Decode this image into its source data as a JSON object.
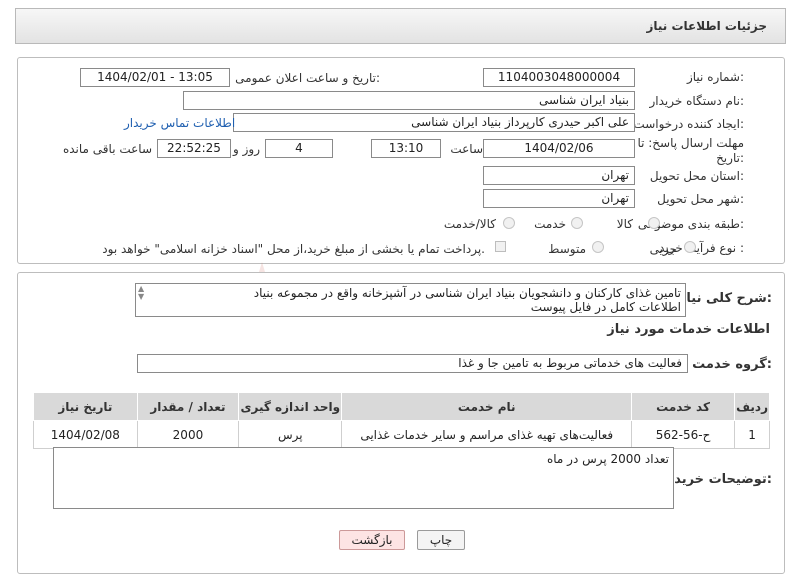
{
  "header": {
    "title": "جزئیات اطلاعات نیاز"
  },
  "fields": {
    "need_number_label": "شماره نیاز:",
    "need_number": "1104003048000004",
    "announce_label": "تاریخ و ساعت اعلان عمومی:",
    "announce_value": "1404/02/01 - 13:05",
    "buyer_org_label": "نام دستگاه خریدار:",
    "buyer_org": "بنیاد ایران شناسی",
    "creator_label": "ایجاد کننده درخواست:",
    "creator": "علی اکبر حیدری کارپرداز بنیاد ایران شناسی",
    "contact_link": "اطلاعات تماس خریدار",
    "deadline_label_1": "مهلت ارسال پاسخ: تا",
    "deadline_label_2": "تاریخ:",
    "deadline_date": "1404/02/06",
    "time_label": "ساعت",
    "deadline_time": "13:10",
    "days_value": "4",
    "days_label": "روز و",
    "remaining_time": "22:52:25",
    "remaining_label": "ساعت باقی مانده",
    "province_label": "استان محل تحویل:",
    "province": "تهران",
    "city_label": "شهر محل تحویل:",
    "city": "تهران",
    "category_label": "طبقه بندی موضوعی:",
    "category_options": [
      "کالا",
      "خدمت",
      "کالا/خدمت"
    ],
    "purchase_type_label": "نوع فرآیند خرید :",
    "purchase_options": [
      "جزیی",
      "متوسط"
    ],
    "payment_note": "پرداخت تمام یا بخشی از مبلغ خرید،از محل \"اسناد خزانه اسلامی\" خواهد بود."
  },
  "description": {
    "label": "شرح کلی نیاز:",
    "line1": "تامین غذای کارکنان و دانشجویان بنیاد ایران شناسی در آشپزخانه واقع در مجموعه بنیاد",
    "line2": "اطلاعات کامل در فایل پیوست"
  },
  "services": {
    "section_title": "اطلاعات خدمات مورد نیاز",
    "group_label": "گروه خدمت:",
    "group_value": "فعالیت های خدماتی مربوط به تامین جا و غذا",
    "columns": [
      "ردیف",
      "کد خدمت",
      "نام خدمت",
      "واحد اندازه گیری",
      "تعداد / مقدار",
      "تاریخ نیاز"
    ],
    "rows": [
      {
        "row": "1",
        "code": "ح-56-562",
        "name": "فعالیت‌های تهیه غذای مراسم و سایر خدمات غذایی",
        "unit": "پرس",
        "qty": "2000",
        "date": "1404/02/08"
      }
    ]
  },
  "buyer_notes": {
    "label": "توضیحات خریدار:",
    "text": "تعداد 2000 پرس در ماه"
  },
  "buttons": {
    "print": "چاپ",
    "back": "بازگشت"
  },
  "colors": {
    "link": "#1f5fb0",
    "back_button_bg": "#fde4e4",
    "header_bg": "#ececec"
  }
}
